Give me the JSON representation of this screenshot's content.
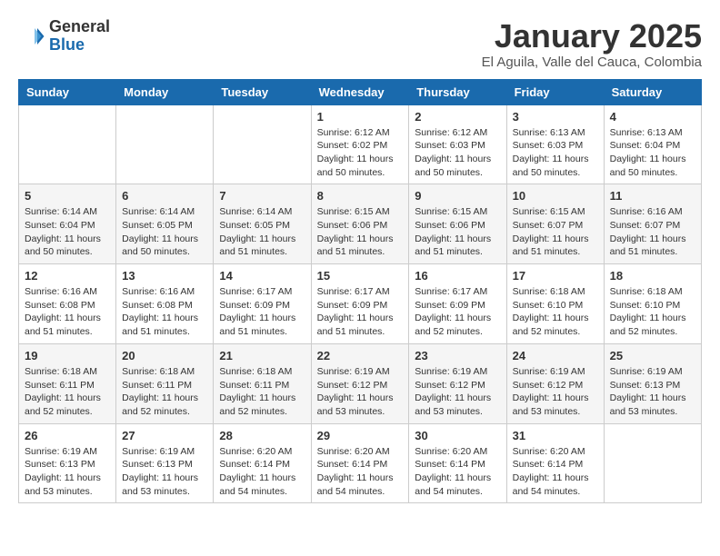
{
  "header": {
    "logo_general": "General",
    "logo_blue": "Blue",
    "month": "January 2025",
    "location": "El Aguila, Valle del Cauca, Colombia"
  },
  "weekdays": [
    "Sunday",
    "Monday",
    "Tuesday",
    "Wednesday",
    "Thursday",
    "Friday",
    "Saturday"
  ],
  "weeks": [
    [
      null,
      null,
      null,
      {
        "day": "1",
        "sunrise": "6:12 AM",
        "sunset": "6:02 PM",
        "daylight": "11 hours and 50 minutes."
      },
      {
        "day": "2",
        "sunrise": "6:12 AM",
        "sunset": "6:03 PM",
        "daylight": "11 hours and 50 minutes."
      },
      {
        "day": "3",
        "sunrise": "6:13 AM",
        "sunset": "6:03 PM",
        "daylight": "11 hours and 50 minutes."
      },
      {
        "day": "4",
        "sunrise": "6:13 AM",
        "sunset": "6:04 PM",
        "daylight": "11 hours and 50 minutes."
      }
    ],
    [
      {
        "day": "5",
        "sunrise": "6:14 AM",
        "sunset": "6:04 PM",
        "daylight": "11 hours and 50 minutes."
      },
      {
        "day": "6",
        "sunrise": "6:14 AM",
        "sunset": "6:05 PM",
        "daylight": "11 hours and 50 minutes."
      },
      {
        "day": "7",
        "sunrise": "6:14 AM",
        "sunset": "6:05 PM",
        "daylight": "11 hours and 51 minutes."
      },
      {
        "day": "8",
        "sunrise": "6:15 AM",
        "sunset": "6:06 PM",
        "daylight": "11 hours and 51 minutes."
      },
      {
        "day": "9",
        "sunrise": "6:15 AM",
        "sunset": "6:06 PM",
        "daylight": "11 hours and 51 minutes."
      },
      {
        "day": "10",
        "sunrise": "6:15 AM",
        "sunset": "6:07 PM",
        "daylight": "11 hours and 51 minutes."
      },
      {
        "day": "11",
        "sunrise": "6:16 AM",
        "sunset": "6:07 PM",
        "daylight": "11 hours and 51 minutes."
      }
    ],
    [
      {
        "day": "12",
        "sunrise": "6:16 AM",
        "sunset": "6:08 PM",
        "daylight": "11 hours and 51 minutes."
      },
      {
        "day": "13",
        "sunrise": "6:16 AM",
        "sunset": "6:08 PM",
        "daylight": "11 hours and 51 minutes."
      },
      {
        "day": "14",
        "sunrise": "6:17 AM",
        "sunset": "6:09 PM",
        "daylight": "11 hours and 51 minutes."
      },
      {
        "day": "15",
        "sunrise": "6:17 AM",
        "sunset": "6:09 PM",
        "daylight": "11 hours and 51 minutes."
      },
      {
        "day": "16",
        "sunrise": "6:17 AM",
        "sunset": "6:09 PM",
        "daylight": "11 hours and 52 minutes."
      },
      {
        "day": "17",
        "sunrise": "6:18 AM",
        "sunset": "6:10 PM",
        "daylight": "11 hours and 52 minutes."
      },
      {
        "day": "18",
        "sunrise": "6:18 AM",
        "sunset": "6:10 PM",
        "daylight": "11 hours and 52 minutes."
      }
    ],
    [
      {
        "day": "19",
        "sunrise": "6:18 AM",
        "sunset": "6:11 PM",
        "daylight": "11 hours and 52 minutes."
      },
      {
        "day": "20",
        "sunrise": "6:18 AM",
        "sunset": "6:11 PM",
        "daylight": "11 hours and 52 minutes."
      },
      {
        "day": "21",
        "sunrise": "6:18 AM",
        "sunset": "6:11 PM",
        "daylight": "11 hours and 52 minutes."
      },
      {
        "day": "22",
        "sunrise": "6:19 AM",
        "sunset": "6:12 PM",
        "daylight": "11 hours and 53 minutes."
      },
      {
        "day": "23",
        "sunrise": "6:19 AM",
        "sunset": "6:12 PM",
        "daylight": "11 hours and 53 minutes."
      },
      {
        "day": "24",
        "sunrise": "6:19 AM",
        "sunset": "6:12 PM",
        "daylight": "11 hours and 53 minutes."
      },
      {
        "day": "25",
        "sunrise": "6:19 AM",
        "sunset": "6:13 PM",
        "daylight": "11 hours and 53 minutes."
      }
    ],
    [
      {
        "day": "26",
        "sunrise": "6:19 AM",
        "sunset": "6:13 PM",
        "daylight": "11 hours and 53 minutes."
      },
      {
        "day": "27",
        "sunrise": "6:19 AM",
        "sunset": "6:13 PM",
        "daylight": "11 hours and 53 minutes."
      },
      {
        "day": "28",
        "sunrise": "6:20 AM",
        "sunset": "6:14 PM",
        "daylight": "11 hours and 54 minutes."
      },
      {
        "day": "29",
        "sunrise": "6:20 AM",
        "sunset": "6:14 PM",
        "daylight": "11 hours and 54 minutes."
      },
      {
        "day": "30",
        "sunrise": "6:20 AM",
        "sunset": "6:14 PM",
        "daylight": "11 hours and 54 minutes."
      },
      {
        "day": "31",
        "sunrise": "6:20 AM",
        "sunset": "6:14 PM",
        "daylight": "11 hours and 54 minutes."
      },
      null
    ]
  ]
}
